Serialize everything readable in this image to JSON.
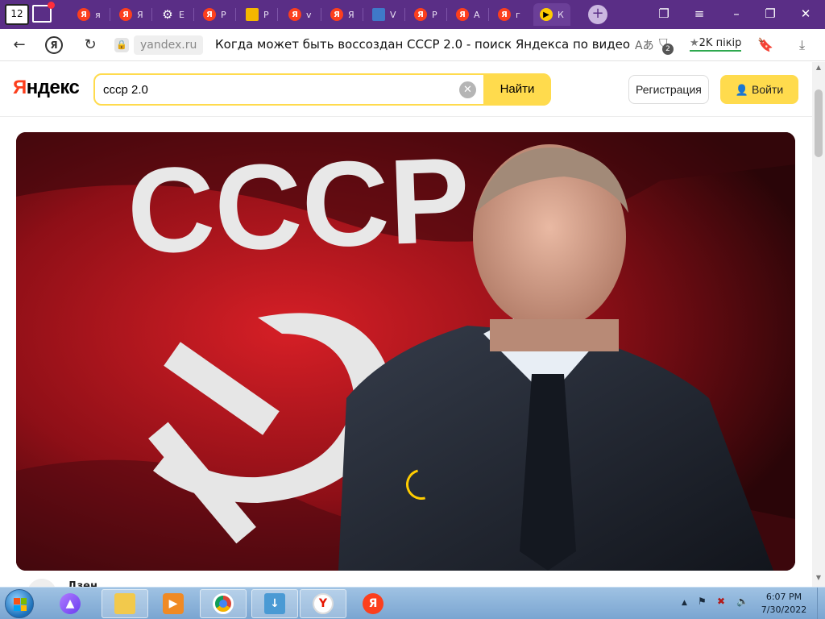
{
  "browser": {
    "tab_count": "12",
    "tabs": [
      {
        "favicon": "yandex-favicon",
        "label": "я"
      },
      {
        "favicon": "yandex-favicon",
        "label": "Я"
      },
      {
        "favicon": "gear-favicon",
        "label": "E"
      },
      {
        "favicon": "yandex-favicon",
        "label": "Р"
      },
      {
        "favicon": "image-favicon",
        "label": "Р"
      },
      {
        "favicon": "yandex-favicon",
        "label": "v"
      },
      {
        "favicon": "yandex-favicon",
        "label": "Я"
      },
      {
        "favicon": "doc-favicon",
        "label": "V"
      },
      {
        "favicon": "yandex-favicon",
        "label": "Р"
      },
      {
        "favicon": "yandex-favicon",
        "label": "А"
      },
      {
        "favicon": "yandex-favicon",
        "label": "г"
      },
      {
        "favicon": "play-favicon",
        "label": "К",
        "active": true
      }
    ],
    "new_tab_label": "+",
    "window_controls": [
      "collections",
      "menu",
      "minimize",
      "restore",
      "close"
    ]
  },
  "addressbar": {
    "domain": "yandex.ru",
    "page_title": "Когда может быть воссоздан СССР 2.0 - поиск Яндекса по видео",
    "notifications_count": "2",
    "rating_text": "2K пікір"
  },
  "yandex": {
    "logo_first": "Я",
    "logo_rest": "ндекс",
    "search_value": "ссср 2.0",
    "find_label": "Найти",
    "register_label": "Регистрация",
    "login_label": "Войти"
  },
  "video": {
    "banner_text": "СССР"
  },
  "below_video": {
    "channel_text": "Дзен"
  },
  "taskbar": {
    "clock_time": "6:07 PM",
    "clock_date": "7/30/2022"
  }
}
